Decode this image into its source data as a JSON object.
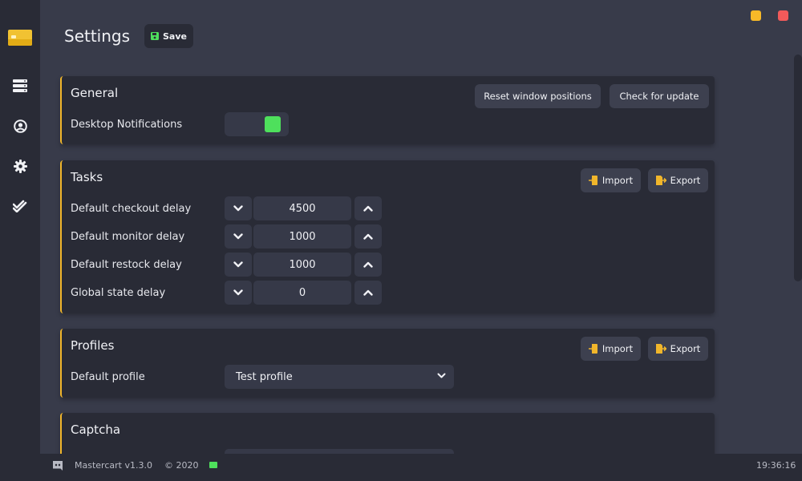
{
  "header": {
    "title": "Settings",
    "save_label": "Save"
  },
  "sidebar": {
    "items": [
      {
        "icon": "server-icon"
      },
      {
        "icon": "user-circle-icon"
      },
      {
        "icon": "gear-icon"
      },
      {
        "icon": "double-check-icon"
      }
    ]
  },
  "general": {
    "title": "General",
    "reset_label": "Reset window positions",
    "update_label": "Check for update",
    "notifications_label": "Desktop Notifications",
    "notifications_on": true
  },
  "tasks": {
    "title": "Tasks",
    "import_label": "Import",
    "export_label": "Export",
    "rows": [
      {
        "label": "Default checkout delay",
        "value": "4500"
      },
      {
        "label": "Default monitor delay",
        "value": "1000"
      },
      {
        "label": "Default restock delay",
        "value": "1000"
      },
      {
        "label": "Global state delay",
        "value": "0"
      }
    ]
  },
  "profiles": {
    "title": "Profiles",
    "import_label": "Import",
    "export_label": "Export",
    "default_label": "Default profile",
    "default_value": "Test profile"
  },
  "captcha": {
    "title": "Captcha"
  },
  "footer": {
    "app_version": "Mastercart v1.3.0",
    "copyright": "© 2020",
    "time": "19:36:16"
  },
  "colors": {
    "accent": "#f1b62b",
    "toggle_on": "#4ee05c",
    "window_min": "#f7b928",
    "window_close": "#f15a5a"
  }
}
